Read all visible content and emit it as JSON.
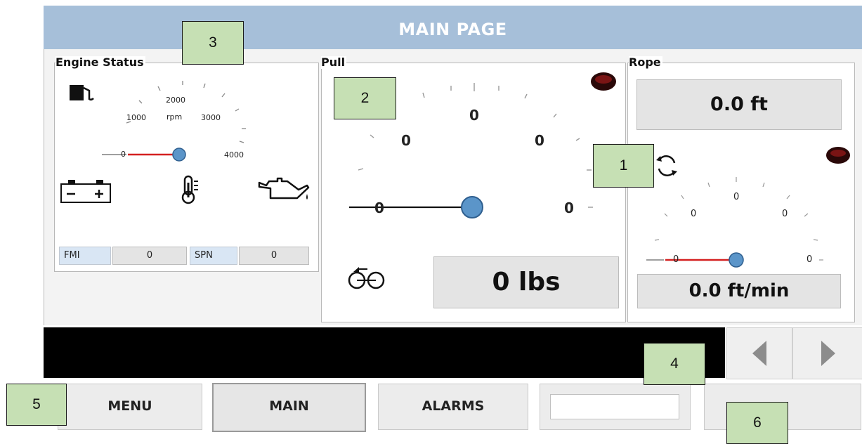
{
  "title": "MAIN PAGE",
  "engine_status": {
    "label": "Engine Status",
    "gauge_ticks": {
      "t1000": "1000",
      "t2000": "2000",
      "unit": "rpm",
      "t3000": "3000",
      "t4000": "4000",
      "t0": "0"
    },
    "fmi_label": "FMI",
    "fmi_value": "0",
    "spn_label": "SPN",
    "spn_value": "0",
    "icons": [
      "fuel-icon",
      "battery-icon",
      "thermometer-icon",
      "oil-can-icon"
    ]
  },
  "pull": {
    "label": "Pull",
    "gauge_ticks": {
      "top": "0",
      "upper_left": "0",
      "upper_right": "0",
      "left": "0",
      "right": "0"
    },
    "readout": "0 lbs",
    "icons": [
      "indicator-light-icon",
      "pulley-icon"
    ]
  },
  "rope": {
    "label": "Rope",
    "length_readout": "0.0 ft",
    "gauge_ticks": {
      "top": "0",
      "upper_left": "0",
      "upper_right": "0",
      "left": "0",
      "right": "0"
    },
    "speed_readout": "0.0 ft/min",
    "icons": [
      "indicator-light-icon",
      "rotate-icon"
    ]
  },
  "nav": {
    "menu": "MENU",
    "main": "MAIN",
    "alarms": "ALARMS",
    "blank_field": ""
  },
  "callouts": {
    "c1": "1",
    "c2": "2",
    "c3": "3",
    "c4": "4",
    "c5": "5",
    "c6": "6"
  },
  "colors": {
    "title_bar": "#a6bfd9",
    "callout_fill": "#c6e0b4",
    "needle_red": "#d42020",
    "knob_blue": "#5b95c9",
    "message_bar": "#000000"
  }
}
